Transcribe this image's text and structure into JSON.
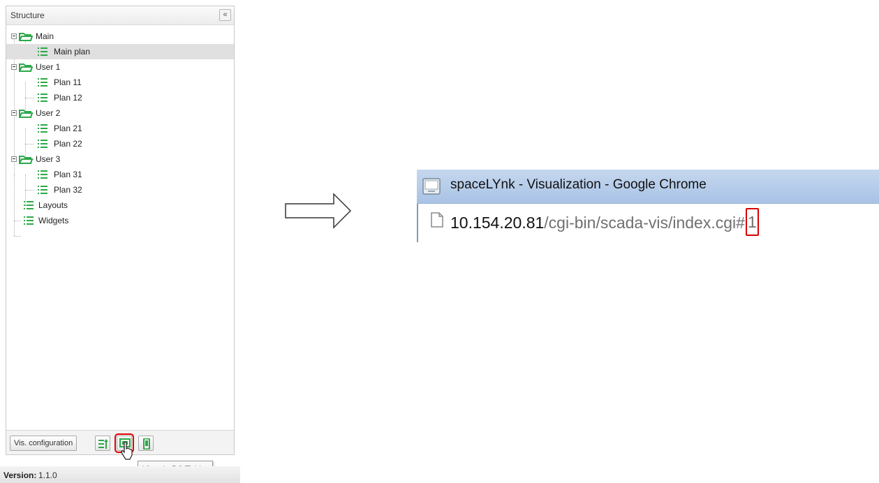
{
  "panel": {
    "title": "Structure",
    "collapse_symbol": "«",
    "tree": [
      {
        "label": "Main",
        "type": "group"
      },
      {
        "label": "Main plan",
        "type": "plan",
        "selected": true
      },
      {
        "label": "User 1",
        "type": "group"
      },
      {
        "label": "Plan 11",
        "type": "plan"
      },
      {
        "label": "Plan 12",
        "type": "plan"
      },
      {
        "label": "User 2",
        "type": "group"
      },
      {
        "label": "Plan 21",
        "type": "plan"
      },
      {
        "label": "Plan 22",
        "type": "plan"
      },
      {
        "label": "User 3",
        "type": "group"
      },
      {
        "label": "Plan 31",
        "type": "plan"
      },
      {
        "label": "Plan 32",
        "type": "plan"
      },
      {
        "label": "Layouts",
        "type": "list"
      },
      {
        "label": "Widgets",
        "type": "list"
      }
    ],
    "footer": {
      "vis_config_label": "Vis. configuration",
      "buttons": [
        "sort-icon",
        "view-pc-tablet-icon",
        "view-mobile-icon"
      ]
    },
    "tooltip": "View in PC/Tablet"
  },
  "version": {
    "label": "Version:",
    "value": "1.1.0"
  },
  "browser": {
    "window_title": "spaceLYnk - Visualization - Google Chrome",
    "url_host": "10.154.20.81",
    "url_path": "/cgi-bin/scada-vis/index.cgi",
    "url_hash": "#",
    "url_plan_id": "1"
  },
  "colors": {
    "accent_green": "#2da84a",
    "highlight_red": "#e00000",
    "title_bar_blue": "#b7cdea",
    "selected_row": "#e0e0e0"
  }
}
